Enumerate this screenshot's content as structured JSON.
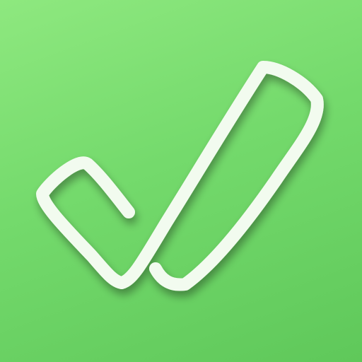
{
  "icon": {
    "name": "check-mark-icon",
    "style": "hand-drawn outline checkmark",
    "colors": {
      "background_top": "#8ee87f",
      "background_mid": "#74da6c",
      "background_bottom": "#5fc85a",
      "stroke": "#f2fbef",
      "stroke_shadow": "#3e9a3c"
    }
  }
}
